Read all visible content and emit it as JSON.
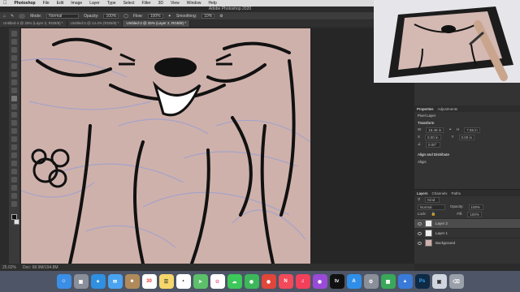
{
  "menubar": {
    "app_name": "Photoshop",
    "items": [
      "File",
      "Edit",
      "Image",
      "Layer",
      "Type",
      "Select",
      "Filter",
      "3D",
      "View",
      "Window",
      "Help"
    ]
  },
  "window_title": "Adobe Photoshop 2020",
  "options_bar": {
    "mode_label": "Mode:",
    "mode_value": "Normal",
    "opacity_label": "Opacity:",
    "opacity_value": "100%",
    "flow_label": "Flow:",
    "flow_value": "100%",
    "smoothing_label": "Smoothing:",
    "smoothing_value": "10%"
  },
  "tabs": [
    "Untitled-4 @ 25% (Layer 2, RGB/8) *",
    "Untitled-2 @ 14.4% (RGB/8) *",
    "Untitled-3 @ 25% (Layer 2, RGB/8) *"
  ],
  "status": {
    "zoom": "25.02%",
    "doc_size": "Doc: 68.9M/194.8M"
  },
  "properties": {
    "tab_properties": "Properties",
    "tab_adjustments": "Adjustments",
    "pixel_layer": "Pixel Layer",
    "transform_heading": "Transform",
    "w_label": "W",
    "w_value": "18.49 in",
    "h_label": "H",
    "h_value": "7.55 in",
    "x_label": "X",
    "x_value": "0.00 in",
    "y_label": "Y",
    "y_value": "0.00 in",
    "angle_value": "0.00°",
    "align_heading": "Align and Distribute",
    "align_sub": "Align:"
  },
  "layers_panel": {
    "tab_layers": "Layers",
    "tab_channels": "Channels",
    "tab_paths": "Paths",
    "kind_label": "Kind",
    "blend_mode": "Normal",
    "opacity_label": "Opacity:",
    "opacity_value": "100%",
    "lock_label": "Lock:",
    "fill_label": "Fill:",
    "fill_value": "100%",
    "layers": [
      "Layer 2",
      "Layer 1",
      "Background"
    ]
  },
  "dock": {
    "calendar_day": "30",
    "apps": [
      "Finder",
      "Launchpad",
      "Safari",
      "Mail",
      "Contacts",
      "Calendar",
      "Notes",
      "Reminders",
      "Maps",
      "Photos",
      "Messages",
      "FaceTime",
      "Chrome",
      "News",
      "Music",
      "Podcasts",
      "TV",
      "App Store",
      "System Preferences",
      "Numbers",
      "Keynote",
      "Photoshop",
      "Preview",
      "Trash"
    ]
  },
  "colors": {
    "canvas": "#cfb1ab",
    "ui_dark": "#333333",
    "dock": "#4d5566"
  }
}
